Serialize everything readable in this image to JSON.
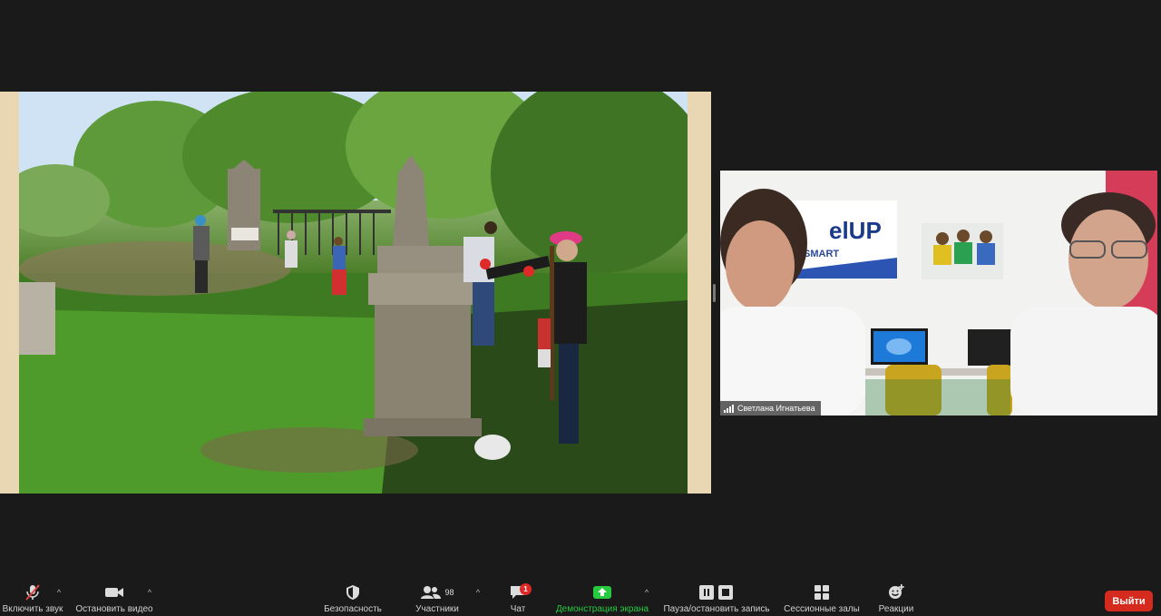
{
  "shared_screen": {
    "content": "photo"
  },
  "participant_video": {
    "name": "Светлана Игнатьева",
    "banner_text_main": "elUP",
    "banner_text_sub": "SMART"
  },
  "toolbar": {
    "unmute_label": "Включить звук",
    "stop_video_label": "Остановить видео",
    "security_label": "Безопасность",
    "participants_label": "Участники",
    "participants_count": "98",
    "chat_label": "Чат",
    "chat_badge": "1",
    "share_label": "Демонстрация экрана",
    "record_label": "Пауза/остановить запись",
    "breakout_label": "Сессионные залы",
    "reactions_label": "Реакции",
    "leave_label": "Выйти"
  },
  "colors": {
    "share_green": "#27c93f",
    "leave_red": "#d52b1e",
    "badge_red": "#e02828",
    "muted_red": "#e04040"
  }
}
